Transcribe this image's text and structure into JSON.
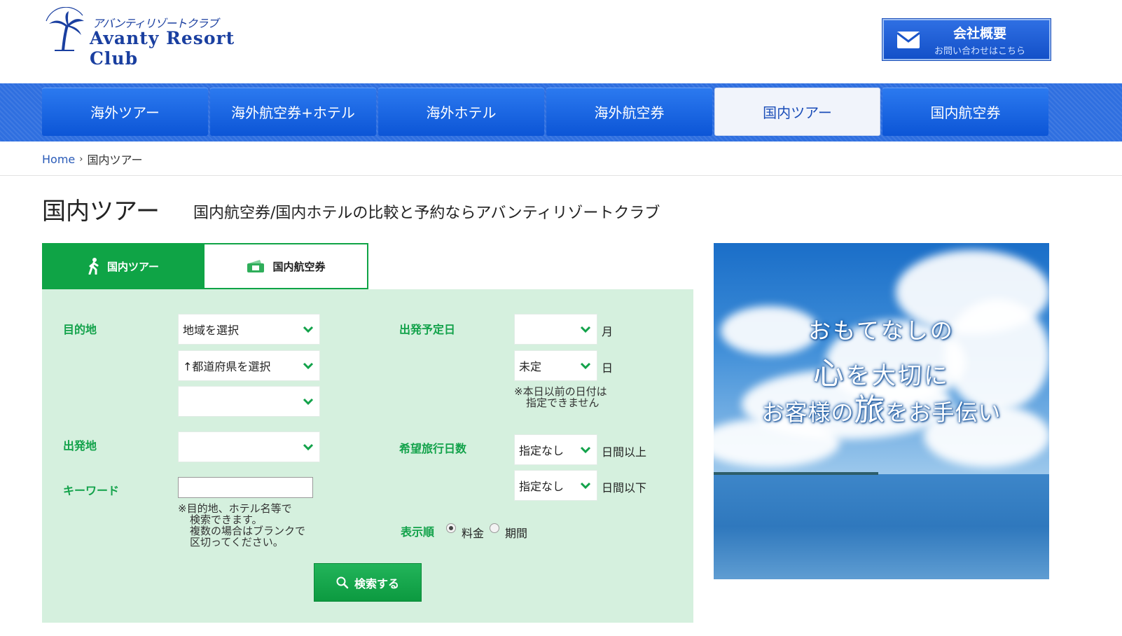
{
  "header": {
    "logo_kana": "アバンティリゾートクラブ",
    "logo_name": "Avanty Resort Club",
    "contact_title": "会社概要",
    "contact_sub": "お問い合わせはこちら"
  },
  "nav": {
    "tabs": [
      {
        "label": "海外ツアー",
        "active": false
      },
      {
        "label": "海外航空券+ホテル",
        "active": false
      },
      {
        "label": "海外ホテル",
        "active": false
      },
      {
        "label": "海外航空券",
        "active": false
      },
      {
        "label": "国内ツアー",
        "active": true
      },
      {
        "label": "国内航空券",
        "active": false
      }
    ]
  },
  "breadcrumb": {
    "home": "Home",
    "current": "国内ツアー"
  },
  "page": {
    "title": "国内ツアー",
    "subtitle": "国内航空券/国内ホテルの比較と予約ならアバンティリゾートクラブ"
  },
  "search_tabs": {
    "tour": "国内ツアー",
    "air": "国内航空券"
  },
  "form": {
    "destination_label": "目的地",
    "region_select": "地域を選択",
    "prefecture_select": "↑都道府県を選択",
    "area_select": "",
    "origin_label": "出発地",
    "origin_select": "",
    "keyword_label": "キーワード",
    "keyword_value": "",
    "keyword_note_1": "※目的地、ホテル名等で",
    "keyword_note_2": "検索できます。",
    "keyword_note_3": "複数の場合はブランクで",
    "keyword_note_4": "区切ってください。",
    "departure_label": "出発予定日",
    "month_select": "",
    "month_unit": "月",
    "day_select": "未定",
    "day_unit": "日",
    "date_note_1": "※本日以前の日付は",
    "date_note_2": "指定できません",
    "days_label": "希望旅行日数",
    "days_min_select": "指定なし",
    "days_min_unit": "日間以上",
    "days_max_select": "指定なし",
    "days_max_unit": "日間以下",
    "sort_label": "表示順",
    "sort_price": "料金",
    "sort_period": "期間",
    "sort_selected": "料金",
    "search_button": "検索する"
  },
  "banner": {
    "line1": "おもてなしの",
    "line2_big": "心",
    "line2_rest": "を大切に",
    "line3_a": "お客様の",
    "line3_big": "旅",
    "line3_b": "をお手伝い"
  },
  "colors": {
    "nav_blue": "#2f6fe0",
    "green": "#0fa446",
    "panel_green": "#d5f0de",
    "link_blue": "#2a5bb8"
  }
}
